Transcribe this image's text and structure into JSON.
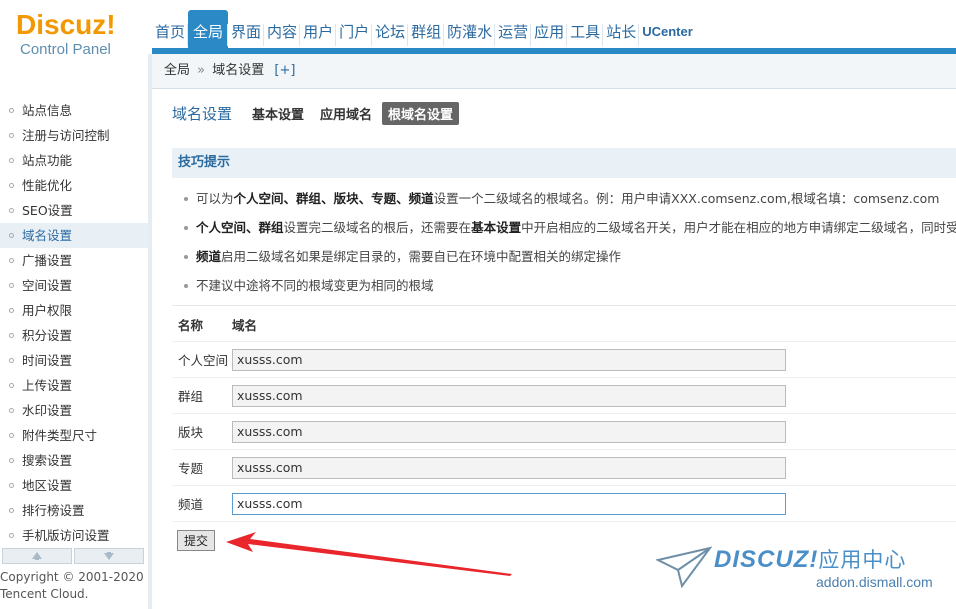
{
  "logo": {
    "title": "Discuz",
    "bang": "!",
    "subtitle": "Control Panel"
  },
  "nav": [
    {
      "label": "首页"
    },
    {
      "label": "全局"
    },
    {
      "label": "界面"
    },
    {
      "label": "内容"
    },
    {
      "label": "用户"
    },
    {
      "label": "门户"
    },
    {
      "label": "论坛"
    },
    {
      "label": "群组"
    },
    {
      "label": "防灌水"
    },
    {
      "label": "运营"
    },
    {
      "label": "应用"
    },
    {
      "label": "工具"
    },
    {
      "label": "站长"
    },
    {
      "label": "UCenter"
    }
  ],
  "nav_active": "全局",
  "breadcrumb": {
    "root": "全局",
    "sep": "»",
    "current": "域名设置",
    "add": "[+]"
  },
  "sidebar": {
    "items": [
      {
        "label": "站点信息"
      },
      {
        "label": "注册与访问控制"
      },
      {
        "label": "站点功能"
      },
      {
        "label": "性能优化"
      },
      {
        "label": "SEO设置"
      },
      {
        "label": "域名设置"
      },
      {
        "label": "广播设置"
      },
      {
        "label": "空间设置"
      },
      {
        "label": "用户权限"
      },
      {
        "label": "积分设置"
      },
      {
        "label": "时间设置"
      },
      {
        "label": "上传设置"
      },
      {
        "label": "水印设置"
      },
      {
        "label": "附件类型尺寸"
      },
      {
        "label": "搜索设置"
      },
      {
        "label": "地区设置"
      },
      {
        "label": "排行榜设置"
      },
      {
        "label": "手机版访问设置"
      }
    ],
    "active": "域名设置",
    "copyright_line1": "Copyright © 2001-2020",
    "copyright_line2": "Tencent Cloud."
  },
  "tabs": {
    "title": "域名设置",
    "items": [
      {
        "label": "基本设置"
      },
      {
        "label": "应用域名"
      },
      {
        "label": "根域名设置"
      }
    ],
    "active": "根域名设置"
  },
  "tips": {
    "title": "技巧提示",
    "items": [
      {
        "parts": [
          "可以为",
          "个人空间",
          "、",
          "群组",
          "、",
          "版块",
          "、",
          "专题",
          "、",
          "频道",
          "设置一个二级域名的根域名。例：用户申请XXX.comsenz.com,根域名填：comsenz.com"
        ]
      },
      {
        "parts": [
          "个人空间",
          "、",
          "群组",
          "设置完二级域名的根后，还需要在",
          "基本设置",
          "中开启相应的二级域名开关，用户才能在相应的地方申请绑定二级域名，同时受限于"
        ]
      },
      {
        "parts": [
          "频道",
          "启用二级域名如果是绑定目录的，需要自已在环境中配置相关的绑定操作"
        ]
      },
      {
        "parts": [
          "不建议中途将不同的根域变更为相同的根域"
        ]
      }
    ]
  },
  "table": {
    "headers": {
      "name": "名称",
      "domain": "域名"
    },
    "rows": [
      {
        "name": "个人空间",
        "value": "xusss.com"
      },
      {
        "name": "群组",
        "value": "xusss.com"
      },
      {
        "name": "版块",
        "value": "xusss.com"
      },
      {
        "name": "专题",
        "value": "xusss.com"
      },
      {
        "name": "频道",
        "value": "xusss.com"
      }
    ]
  },
  "submit_label": "提交",
  "watermark": {
    "brand": "DISCUZ!",
    "cn": "应用中心",
    "url": "addon.dismall.com"
  },
  "colors": {
    "accent": "#2b8ac6",
    "logo": "#f39800",
    "arrow": "#e8262b"
  }
}
